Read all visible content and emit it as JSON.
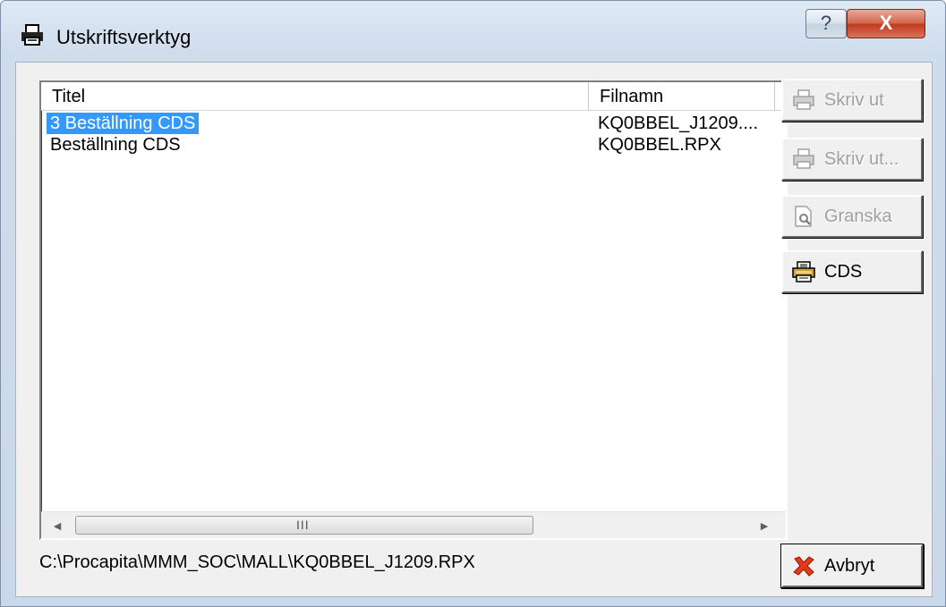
{
  "window": {
    "title": "Utskriftsverktyg",
    "help_glyph": "?",
    "close_glyph": "X"
  },
  "list": {
    "columns": [
      "Titel",
      "Filnamn"
    ],
    "rows": [
      {
        "title": "3 Beställning CDS",
        "file": "KQ0BBEL_J1209....",
        "selected": true
      },
      {
        "title": "Beställning CDS",
        "file": "KQ0BBEL.RPX",
        "selected": false
      }
    ],
    "scroll_left": "◄",
    "scroll_right": "►",
    "scroll_grip": "III"
  },
  "path": "C:\\Procapita\\MMM_SOC\\MALL\\KQ0BBEL_J1209.RPX",
  "buttons": {
    "print": {
      "label": "Skriv ut",
      "icon": "printer-icon",
      "enabled": false
    },
    "print_dialog": {
      "label": "Skriv ut...",
      "icon": "printer-icon",
      "enabled": false
    },
    "preview": {
      "label": "Granska",
      "icon": "preview-document-icon",
      "enabled": false
    },
    "cds": {
      "label": "CDS",
      "icon": "cds-printer-icon",
      "enabled": true
    },
    "cancel": {
      "label": "Avbryt",
      "icon": "red-x-icon",
      "enabled": true
    }
  },
  "colors": {
    "selection": "#3399ff",
    "disabled_text": "#a0a0a0"
  }
}
